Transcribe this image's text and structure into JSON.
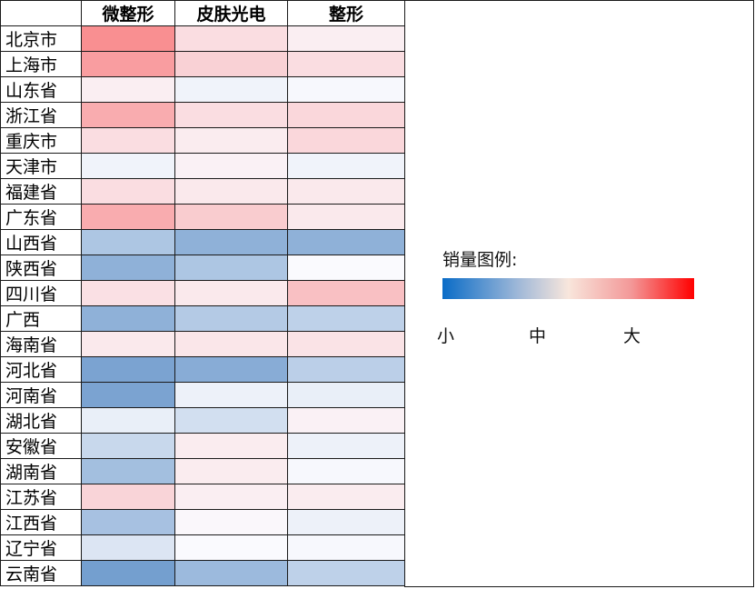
{
  "chart_data": {
    "type": "heatmap",
    "columns": [
      "微整形",
      "皮肤光电",
      "整形"
    ],
    "rows": [
      "北京市",
      "上海市",
      "山东省",
      "浙江省",
      "重庆市",
      "天津市",
      "福建省",
      "广东省",
      "山西省",
      "陕西省",
      "四川省",
      "广西",
      "海南省",
      "河北省",
      "河南省",
      "湖北省",
      "安徽省",
      "湖南省",
      "江苏省",
      "江西省",
      "辽宁省",
      "云南省"
    ],
    "values": [
      [
        0.87,
        0.6,
        0.54
      ],
      [
        0.82,
        0.64,
        0.6
      ],
      [
        0.54,
        0.47,
        0.49
      ],
      [
        0.77,
        0.6,
        0.62
      ],
      [
        0.6,
        0.55,
        0.62
      ],
      [
        0.47,
        0.53,
        0.47
      ],
      [
        0.6,
        0.56,
        0.56
      ],
      [
        0.77,
        0.66,
        0.56
      ],
      [
        0.27,
        0.18,
        0.18
      ],
      [
        0.18,
        0.27,
        0.5
      ],
      [
        0.59,
        0.56,
        0.7
      ],
      [
        0.18,
        0.29,
        0.32
      ],
      [
        0.56,
        0.57,
        0.58
      ],
      [
        0.12,
        0.16,
        0.31
      ],
      [
        0.12,
        0.46,
        0.45
      ],
      [
        0.45,
        0.38,
        0.53
      ],
      [
        0.35,
        0.55,
        0.46
      ],
      [
        0.24,
        0.55,
        0.49
      ],
      [
        0.63,
        0.54,
        0.55
      ],
      [
        0.25,
        0.51,
        0.46
      ],
      [
        0.41,
        0.5,
        0.49
      ],
      [
        0.1,
        0.22,
        0.32
      ]
    ],
    "legend": {
      "title": "销量图例:",
      "min_label": "小",
      "mid_label": "中",
      "max_label": "大",
      "colors": {
        "low": "#0a6cc7",
        "mid": "#f8e6dc",
        "high": "#ff0000"
      },
      "placement": "right"
    }
  }
}
